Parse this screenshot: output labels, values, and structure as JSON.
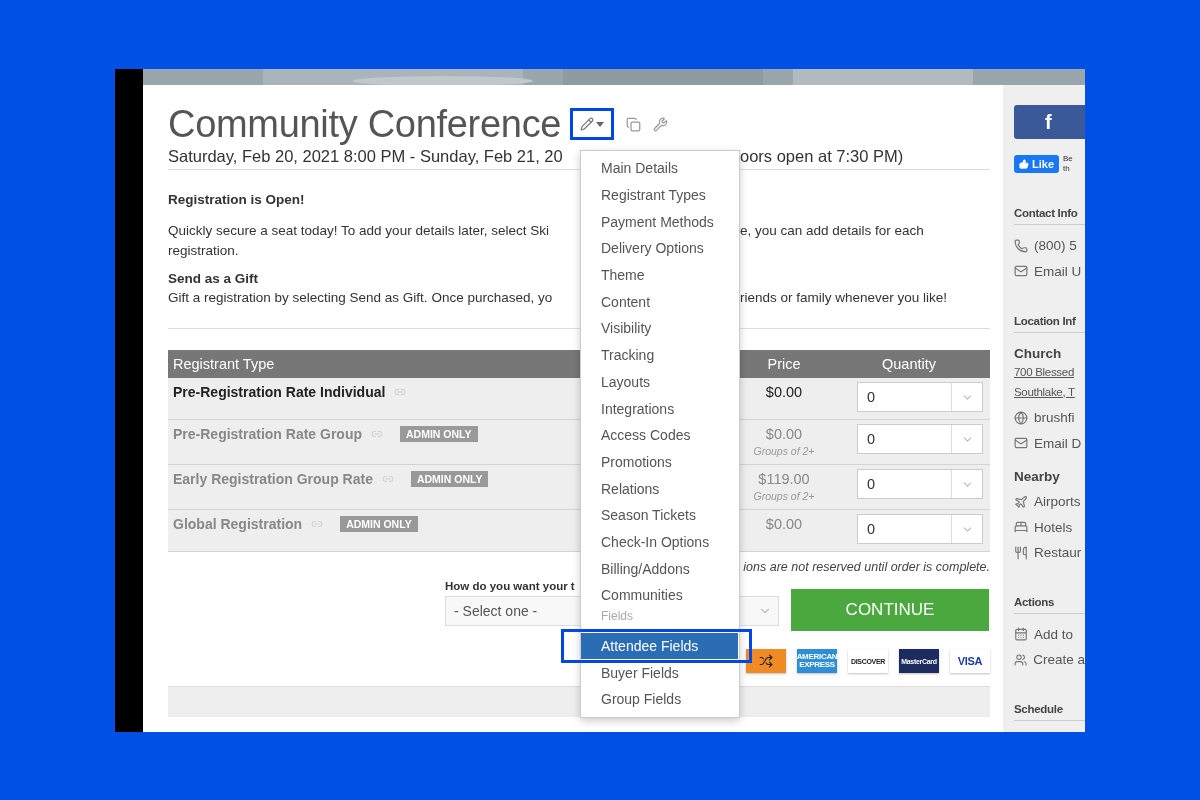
{
  "event": {
    "title": "Community Conference",
    "edit_button": {
      "highlighted": true
    },
    "date_left": "Saturday, Feb 20, 2021 8:00 PM - Sunday, Feb 21, 20",
    "date_right": "oors open at 7:30 PM)",
    "status_heading": "Registration is Open!",
    "intro_left": "Quickly secure a seat today! To add your details later, select Ski",
    "intro_right": "e, you can add details for each",
    "intro_line2": "registration.",
    "gift_heading": "Send as a Gift",
    "gift_left": "Gift a registration by selecting Send as Gift. Once purchased, yo",
    "gift_right": "riends or family whenever you like!"
  },
  "table": {
    "columns": [
      "Registrant Type",
      "Price",
      "Quantity"
    ],
    "rows": [
      {
        "name": "Pre-Registration Rate Individual",
        "muted": false,
        "price": "$0.00",
        "quantity": "0"
      },
      {
        "name": "Pre-Registration Rate Group",
        "muted": true,
        "badge": "ADMIN ONLY",
        "price": "$0.00",
        "note": "Groups of 2+",
        "quantity": "0"
      },
      {
        "name": "Early Registration Group Rate",
        "muted": true,
        "badge": "ADMIN ONLY",
        "price": "$119.00",
        "note": "Groups of 2+",
        "quantity": "0"
      },
      {
        "name": "Global Registration",
        "muted": true,
        "badge": "ADMIN ONLY",
        "price": "$0.00",
        "quantity": "0"
      }
    ],
    "footnote": "ions are not reserved until order is complete."
  },
  "delivery": {
    "label": "How do you want your t",
    "placeholder": "- Select one -"
  },
  "continue_button": "CONTINUE",
  "payment_cards": [
    {
      "kind": "shuffle"
    },
    {
      "kind": "amex",
      "label": "AMERICAN EXPRESS"
    },
    {
      "kind": "discover",
      "label": "DISCOVER"
    },
    {
      "kind": "mastercard",
      "label": "MasterCard"
    },
    {
      "kind": "visa",
      "label": "VISA"
    }
  ],
  "menu": {
    "items": [
      {
        "kind": "item",
        "label": "Main Details",
        "selected": false,
        "highlighted": false
      },
      {
        "kind": "item",
        "label": "Registrant Types",
        "selected": false,
        "highlighted": false
      },
      {
        "kind": "item",
        "label": "Payment Methods",
        "selected": false,
        "highlighted": false
      },
      {
        "kind": "item",
        "label": "Delivery Options",
        "selected": false,
        "highlighted": false
      },
      {
        "kind": "item",
        "label": "Theme",
        "selected": false,
        "highlighted": false
      },
      {
        "kind": "item",
        "label": "Content",
        "selected": false,
        "highlighted": false
      },
      {
        "kind": "item",
        "label": "Visibility",
        "selected": false,
        "highlighted": false
      },
      {
        "kind": "item",
        "label": "Tracking",
        "selected": false,
        "highlighted": false
      },
      {
        "kind": "item",
        "label": "Layouts",
        "selected": false,
        "highlighted": false
      },
      {
        "kind": "item",
        "label": "Integrations",
        "selected": false,
        "highlighted": false
      },
      {
        "kind": "item",
        "label": "Access Codes",
        "selected": false,
        "highlighted": false
      },
      {
        "kind": "item",
        "label": "Promotions",
        "selected": false,
        "highlighted": false
      },
      {
        "kind": "item",
        "label": "Relations",
        "selected": false,
        "highlighted": false
      },
      {
        "kind": "item",
        "label": "Season Tickets",
        "selected": false,
        "highlighted": false
      },
      {
        "kind": "item",
        "label": "Check-In Options",
        "selected": false,
        "highlighted": false
      },
      {
        "kind": "item",
        "label": "Billing/Addons",
        "selected": false,
        "highlighted": false
      },
      {
        "kind": "item",
        "label": "Communities",
        "selected": false,
        "highlighted": false
      },
      {
        "kind": "heading",
        "label": "Fields"
      },
      {
        "kind": "item",
        "label": "Attendee Fields",
        "selected": true,
        "highlighted": true
      },
      {
        "kind": "item",
        "label": "Buyer Fields",
        "selected": false,
        "highlighted": false
      },
      {
        "kind": "item",
        "label": "Group Fields",
        "selected": false,
        "highlighted": false
      }
    ]
  },
  "sidebar": {
    "facebook_button": "f",
    "like_button": "Like",
    "like_note": [
      "Be",
      "th"
    ],
    "sections": [
      {
        "title": "Contact Info",
        "items": [
          {
            "kind": "phone",
            "text": "(800) 5"
          },
          {
            "kind": "mail",
            "text": "Email U"
          }
        ]
      },
      {
        "title": "Location Inf",
        "items": [
          {
            "kind": "heading",
            "text": "Church"
          },
          {
            "kind": "address",
            "text": "700 Blessed"
          },
          {
            "kind": "address",
            "text": "Southlake, T"
          },
          {
            "kind": "globe",
            "text": "brushfi"
          },
          {
            "kind": "mail",
            "text": "Email D"
          },
          {
            "kind": "heading",
            "text": "Nearby"
          },
          {
            "kind": "plane",
            "text": "Airports"
          },
          {
            "kind": "bed",
            "text": "Hotels"
          },
          {
            "kind": "food",
            "text": "Restaur"
          }
        ]
      },
      {
        "title": "Actions",
        "items": [
          {
            "kind": "calendar",
            "text": "Add to"
          },
          {
            "kind": "people",
            "text": "Create a"
          }
        ]
      },
      {
        "title": "Schedule"
      }
    ]
  }
}
